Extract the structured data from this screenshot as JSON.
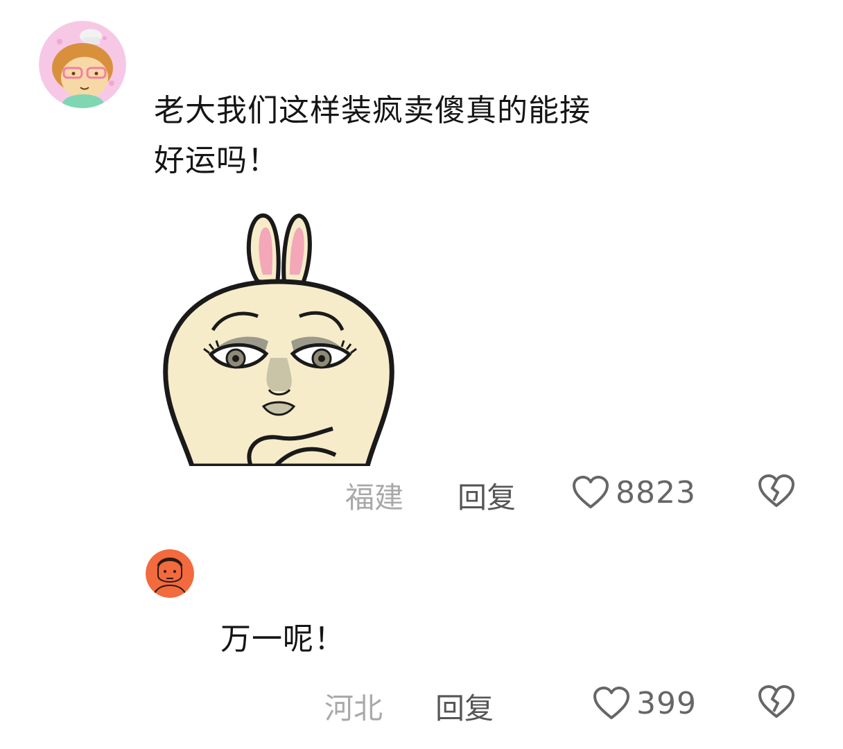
{
  "comments": [
    {
      "text": "老大我们这样装疯卖傻真的能接\n好运吗！",
      "location": "福建",
      "reply_label": "回复",
      "likes": "8823",
      "avatar": "girl-chef-avatar",
      "attachment": "bunny-sticker"
    },
    {
      "text": "万一呢！",
      "location": "河北",
      "reply_label": "回复",
      "likes": "399",
      "avatar": "orange-man-avatar"
    }
  ],
  "icons": {
    "like": "heart-outline-icon",
    "dislike": "broken-heart-icon"
  },
  "colors": {
    "location": "#a9a9a9",
    "reply": "#555555",
    "like_count": "#666666",
    "text": "#151515"
  }
}
